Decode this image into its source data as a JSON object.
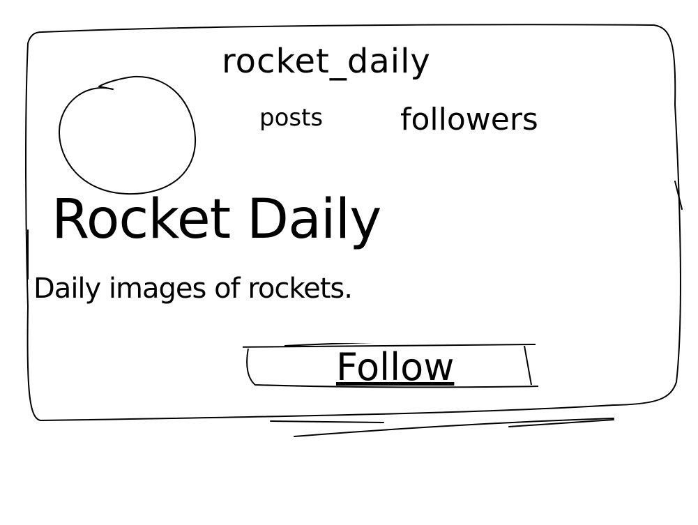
{
  "profile": {
    "username": "rocket_daily",
    "stats": {
      "posts_label": "posts",
      "followers_label": "followers"
    },
    "display_name": "Rocket Daily",
    "bio": "Daily images of rockets."
  },
  "actions": {
    "follow_label": "Follow"
  }
}
